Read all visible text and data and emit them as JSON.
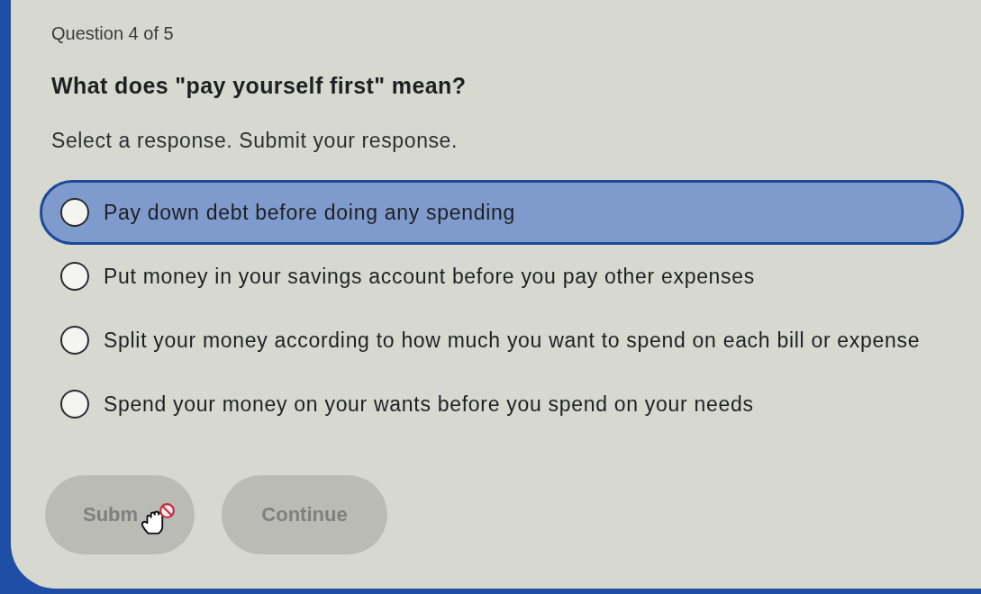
{
  "progress": "Question 4 of 5",
  "question": "What does \"pay yourself first\" mean?",
  "instructions": "Select a response. Submit your response.",
  "options": [
    {
      "label": "Pay down debt before doing any spending",
      "selected": false,
      "highlighted": true
    },
    {
      "label": "Put money in your savings account before you pay other expenses",
      "selected": false,
      "highlighted": false
    },
    {
      "label": "Split your money according to how much you want to spend on each bill or expense",
      "selected": false,
      "highlighted": false
    },
    {
      "label": "Spend your money on your wants before you spend on your needs",
      "selected": false,
      "highlighted": false
    }
  ],
  "buttons": [
    {
      "label": "Subm",
      "disabled": true
    },
    {
      "label": "Continue",
      "disabled": true
    }
  ]
}
